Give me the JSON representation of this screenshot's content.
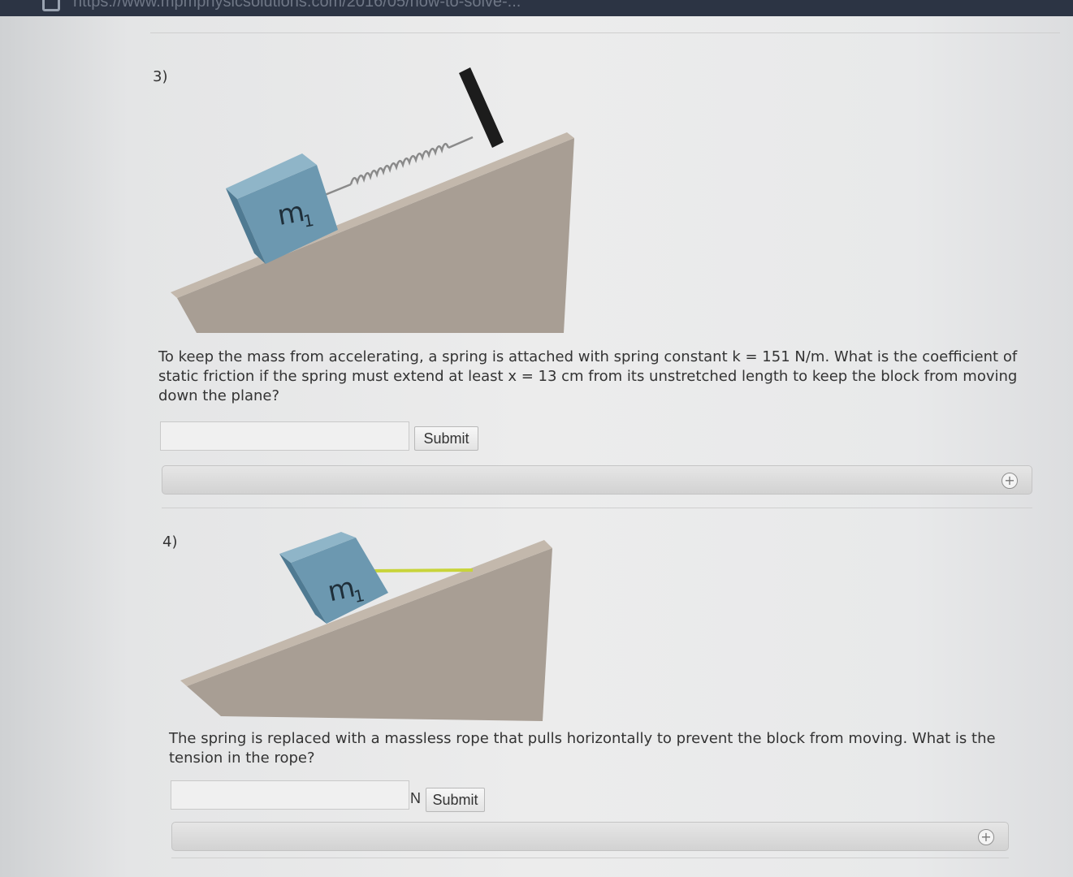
{
  "browser": {
    "url_fragment": "https://www.mpmphysicsolutions.com/2016/05/how-to-solve-..."
  },
  "questions": [
    {
      "number": "3)",
      "block_label": "m",
      "block_subscript": "1",
      "text": "To keep the mass from accelerating, a spring is attached with spring constant k = 151 N/m. What is the coefficient of static friction if the spring must extend at least x = 13 cm from its unstretched length to keep the block from moving down the plane?",
      "input_value": "",
      "unit": "",
      "submit_label": "Submit",
      "expand_icon": "plus-circle-icon"
    },
    {
      "number": "4)",
      "block_label": "m",
      "block_subscript": "1",
      "text": "The spring is replaced with a massless rope that pulls horizontally to prevent the block from moving. What is the tension in the rope?",
      "input_value": "",
      "unit": "N",
      "submit_label": "Submit",
      "expand_icon": "plus-circle-icon"
    }
  ],
  "colors": {
    "ramp_face": "#a89e94",
    "ramp_top": "#c3b8ac",
    "block_front": "#6c98b0",
    "block_top": "#8fb5c8",
    "rope": "#c8d43a",
    "wall": "#1c1c1c"
  }
}
